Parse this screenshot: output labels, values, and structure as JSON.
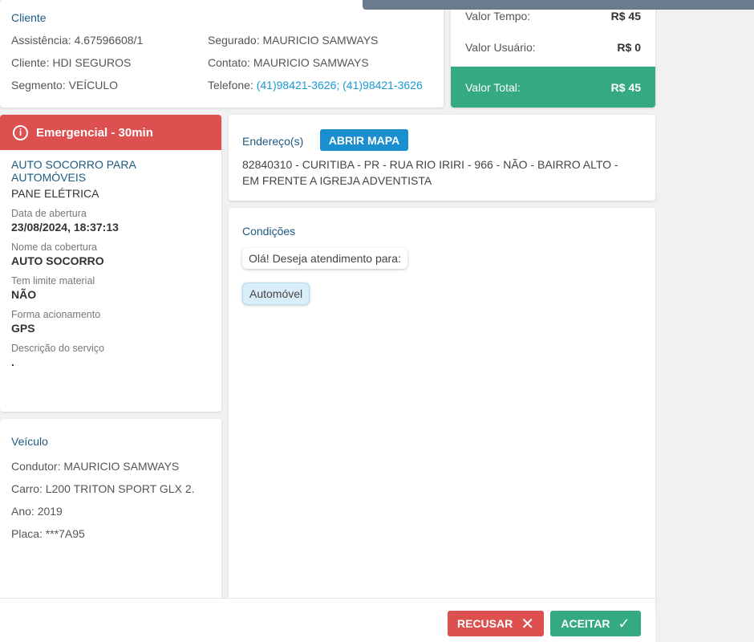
{
  "cliente": {
    "title": "Cliente",
    "assistencia": "Assistência: 4.67596608/1",
    "cliente": "Cliente: HDI SEGUROS",
    "segmento": "Segmento: VEÍCULO",
    "segurado": "Segurado: MAURICIO SAMWAYS",
    "contato": "Contato: MAURICIO SAMWAYS",
    "telefone_label": "Telefone: ",
    "telefone": "(41)98421-3626; (41)98421-3626"
  },
  "valores": {
    "tempo_label": "Valor Tempo:",
    "tempo": "R$ 45",
    "usuario_label": "Valor Usuário:",
    "usuario": "R$ 0",
    "total_label": "Valor Total:",
    "total": "R$ 45",
    "total_color": "#35a97f"
  },
  "servico": {
    "priority": "Emergencial - 30min",
    "priority_color": "#dc5050",
    "title": "AUTO SOCORRO PARA AUTOMÓVEIS",
    "subtitle": "PANE ELÉTRICA",
    "fields": [
      {
        "label": "Data de abertura",
        "value": "23/08/2024, 18:37:13"
      },
      {
        "label": "Nome da cobertura",
        "value": "AUTO SOCORRO"
      },
      {
        "label": "Tem limite material",
        "value": "NÃO"
      },
      {
        "label": "Forma acionamento",
        "value": "GPS"
      },
      {
        "label": "Descrição do serviço",
        "value": "."
      }
    ]
  },
  "veiculo": {
    "title": "Veículo",
    "condutor": "Condutor: MAURICIO SAMWAYS",
    "carro": "Carro: L200 TRITON SPORT GLX 2.",
    "ano": "Ano: 2019",
    "placa": "Placa: ***7A95"
  },
  "endereco": {
    "title": "Endereço(s)",
    "map_button": "ABRIR MAPA",
    "address": "82840310 - CURITIBA - PR - RUA RIO IRIRI - 966 - NÃO - BAIRRO ALTO - EM FRENTE A IGREJA ADVENTISTA"
  },
  "condicoes": {
    "title": "Condições",
    "question": "Olá! Deseja atendimento para:",
    "answer": "Automóvel"
  },
  "actions": {
    "refuse": "RECUSAR",
    "accept": "ACEITAR"
  }
}
